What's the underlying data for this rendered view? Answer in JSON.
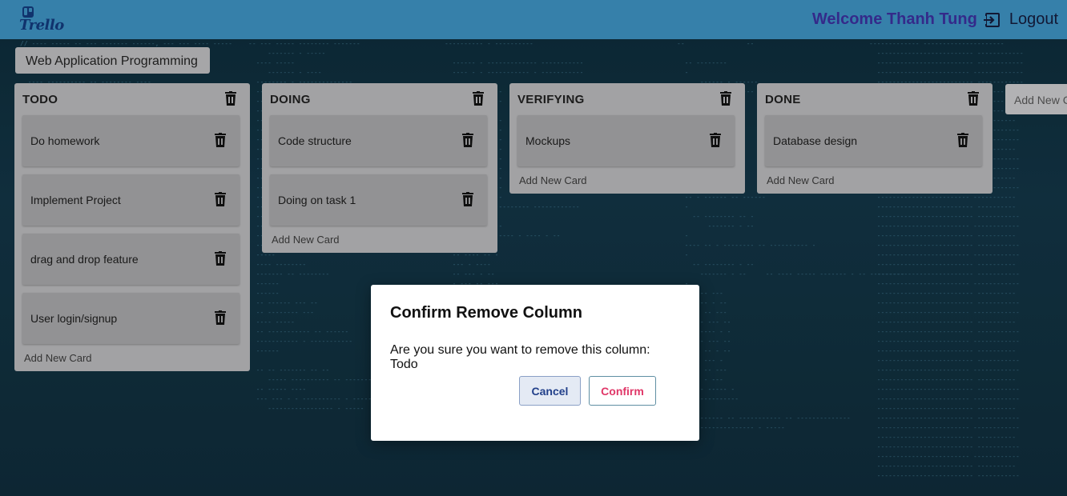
{
  "header": {
    "logo_text": "Trello",
    "welcome": "Welcome Thanh Tung",
    "logout_label": "Logout"
  },
  "board": {
    "title": "Web Application Programming",
    "add_column_label": "Add New Column",
    "columns": [
      {
        "title": "TODO",
        "cards": [
          "Do homework",
          "Implement Project",
          "drag and drop feature",
          "User login/signup"
        ],
        "add_card_label": "Add New Card"
      },
      {
        "title": "DOING",
        "cards": [
          "Code structure",
          "Doing on task 1"
        ],
        "add_card_label": "Add New Card"
      },
      {
        "title": "VERIFYING",
        "cards": [
          "Mockups"
        ],
        "add_card_label": "Add New Card"
      },
      {
        "title": "DONE",
        "cards": [
          "Database design"
        ],
        "add_card_label": "Add New Card"
      }
    ]
  },
  "dialog": {
    "title": "Confirm Remove Column",
    "message": "Are you sure you want to remove this column: Todo",
    "cancel_label": "Cancel",
    "confirm_label": "Confirm"
  },
  "colors": {
    "topbar": "#3d8fbe",
    "welcome": "#3a2f9a",
    "column_bg": "#b5b5b7",
    "card_bg": "#a3a3a5",
    "confirm_text": "#e03768",
    "cancel_text": "#22408a"
  },
  "icons": {
    "logo": "trello-logo-icon",
    "logout": "logout-icon",
    "delete": "trash-icon"
  }
}
